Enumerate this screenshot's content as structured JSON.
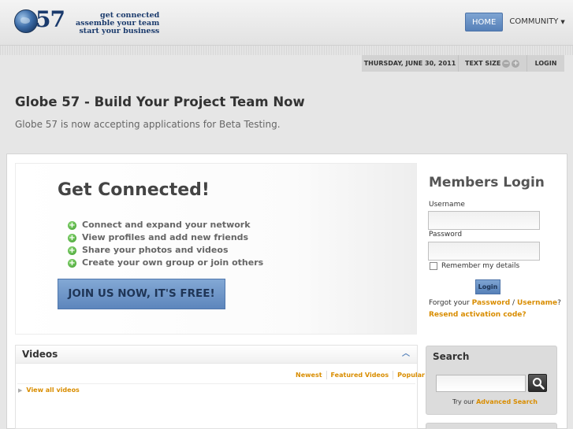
{
  "header": {
    "logo_number": "57",
    "tagline": [
      "get connected",
      "assemble your team",
      "start your business"
    ],
    "nav": {
      "home": "HOME",
      "community": "COMMUNITY"
    }
  },
  "utility": {
    "date": "THURSDAY, JUNE 30, 2011",
    "text_size": "TEXT SIZE",
    "decrease": "−",
    "increase": "+",
    "login": "LOGIN"
  },
  "page": {
    "title": "Globe 57 - Build Your Project Team Now",
    "subtitle": "Globe 57 is now accepting applications for Beta Testing."
  },
  "hero": {
    "title": "Get Connected!",
    "features": [
      "Connect and expand your network",
      "View profiles and add new friends",
      "Share your photos and videos",
      "Create your own group or join others"
    ],
    "join_button": "JOIN US NOW, IT'S FREE!"
  },
  "login": {
    "title": "Members Login",
    "username_label": "Username",
    "password_label": "Password",
    "remember_label": "Remember my details",
    "button": "Login",
    "forgot_prefix": "Forgot your",
    "forgot_password": "Password",
    "forgot_sep": "/",
    "forgot_username": "Username",
    "forgot_suffix": "?",
    "resend": "Resend activation code?"
  },
  "videos": {
    "title": "Videos",
    "tabs": [
      "Newest",
      "Featured Videos",
      "Popular"
    ],
    "view_all": "View all videos"
  },
  "search": {
    "title": "Search",
    "hint_prefix": "Try our",
    "advanced_link": "Advanced Search"
  },
  "colors": {
    "accent_blue": "#5d86bc",
    "link_orange": "#d98d00",
    "logo_navy": "#1a3a6c"
  }
}
